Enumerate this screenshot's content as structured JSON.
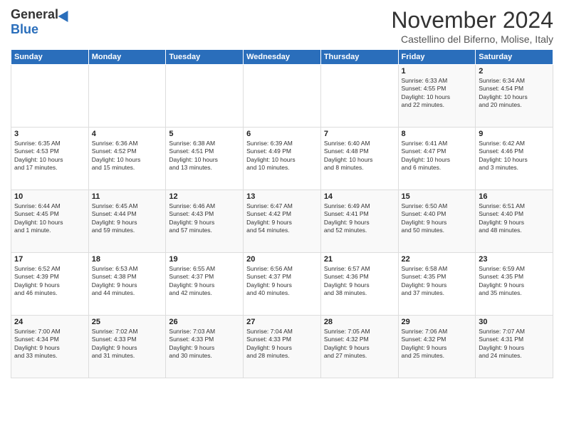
{
  "header": {
    "logo_general": "General",
    "logo_blue": "Blue",
    "month": "November 2024",
    "location": "Castellino del Biferno, Molise, Italy"
  },
  "days_of_week": [
    "Sunday",
    "Monday",
    "Tuesday",
    "Wednesday",
    "Thursday",
    "Friday",
    "Saturday"
  ],
  "weeks": [
    [
      {
        "day": "",
        "info": ""
      },
      {
        "day": "",
        "info": ""
      },
      {
        "day": "",
        "info": ""
      },
      {
        "day": "",
        "info": ""
      },
      {
        "day": "",
        "info": ""
      },
      {
        "day": "1",
        "info": "Sunrise: 6:33 AM\nSunset: 4:55 PM\nDaylight: 10 hours\nand 22 minutes."
      },
      {
        "day": "2",
        "info": "Sunrise: 6:34 AM\nSunset: 4:54 PM\nDaylight: 10 hours\nand 20 minutes."
      }
    ],
    [
      {
        "day": "3",
        "info": "Sunrise: 6:35 AM\nSunset: 4:53 PM\nDaylight: 10 hours\nand 17 minutes."
      },
      {
        "day": "4",
        "info": "Sunrise: 6:36 AM\nSunset: 4:52 PM\nDaylight: 10 hours\nand 15 minutes."
      },
      {
        "day": "5",
        "info": "Sunrise: 6:38 AM\nSunset: 4:51 PM\nDaylight: 10 hours\nand 13 minutes."
      },
      {
        "day": "6",
        "info": "Sunrise: 6:39 AM\nSunset: 4:49 PM\nDaylight: 10 hours\nand 10 minutes."
      },
      {
        "day": "7",
        "info": "Sunrise: 6:40 AM\nSunset: 4:48 PM\nDaylight: 10 hours\nand 8 minutes."
      },
      {
        "day": "8",
        "info": "Sunrise: 6:41 AM\nSunset: 4:47 PM\nDaylight: 10 hours\nand 6 minutes."
      },
      {
        "day": "9",
        "info": "Sunrise: 6:42 AM\nSunset: 4:46 PM\nDaylight: 10 hours\nand 3 minutes."
      }
    ],
    [
      {
        "day": "10",
        "info": "Sunrise: 6:44 AM\nSunset: 4:45 PM\nDaylight: 10 hours\nand 1 minute."
      },
      {
        "day": "11",
        "info": "Sunrise: 6:45 AM\nSunset: 4:44 PM\nDaylight: 9 hours\nand 59 minutes."
      },
      {
        "day": "12",
        "info": "Sunrise: 6:46 AM\nSunset: 4:43 PM\nDaylight: 9 hours\nand 57 minutes."
      },
      {
        "day": "13",
        "info": "Sunrise: 6:47 AM\nSunset: 4:42 PM\nDaylight: 9 hours\nand 54 minutes."
      },
      {
        "day": "14",
        "info": "Sunrise: 6:49 AM\nSunset: 4:41 PM\nDaylight: 9 hours\nand 52 minutes."
      },
      {
        "day": "15",
        "info": "Sunrise: 6:50 AM\nSunset: 4:40 PM\nDaylight: 9 hours\nand 50 minutes."
      },
      {
        "day": "16",
        "info": "Sunrise: 6:51 AM\nSunset: 4:40 PM\nDaylight: 9 hours\nand 48 minutes."
      }
    ],
    [
      {
        "day": "17",
        "info": "Sunrise: 6:52 AM\nSunset: 4:39 PM\nDaylight: 9 hours\nand 46 minutes."
      },
      {
        "day": "18",
        "info": "Sunrise: 6:53 AM\nSunset: 4:38 PM\nDaylight: 9 hours\nand 44 minutes."
      },
      {
        "day": "19",
        "info": "Sunrise: 6:55 AM\nSunset: 4:37 PM\nDaylight: 9 hours\nand 42 minutes."
      },
      {
        "day": "20",
        "info": "Sunrise: 6:56 AM\nSunset: 4:37 PM\nDaylight: 9 hours\nand 40 minutes."
      },
      {
        "day": "21",
        "info": "Sunrise: 6:57 AM\nSunset: 4:36 PM\nDaylight: 9 hours\nand 38 minutes."
      },
      {
        "day": "22",
        "info": "Sunrise: 6:58 AM\nSunset: 4:35 PM\nDaylight: 9 hours\nand 37 minutes."
      },
      {
        "day": "23",
        "info": "Sunrise: 6:59 AM\nSunset: 4:35 PM\nDaylight: 9 hours\nand 35 minutes."
      }
    ],
    [
      {
        "day": "24",
        "info": "Sunrise: 7:00 AM\nSunset: 4:34 PM\nDaylight: 9 hours\nand 33 minutes."
      },
      {
        "day": "25",
        "info": "Sunrise: 7:02 AM\nSunset: 4:33 PM\nDaylight: 9 hours\nand 31 minutes."
      },
      {
        "day": "26",
        "info": "Sunrise: 7:03 AM\nSunset: 4:33 PM\nDaylight: 9 hours\nand 30 minutes."
      },
      {
        "day": "27",
        "info": "Sunrise: 7:04 AM\nSunset: 4:33 PM\nDaylight: 9 hours\nand 28 minutes."
      },
      {
        "day": "28",
        "info": "Sunrise: 7:05 AM\nSunset: 4:32 PM\nDaylight: 9 hours\nand 27 minutes."
      },
      {
        "day": "29",
        "info": "Sunrise: 7:06 AM\nSunset: 4:32 PM\nDaylight: 9 hours\nand 25 minutes."
      },
      {
        "day": "30",
        "info": "Sunrise: 7:07 AM\nSunset: 4:31 PM\nDaylight: 9 hours\nand 24 minutes."
      }
    ]
  ]
}
